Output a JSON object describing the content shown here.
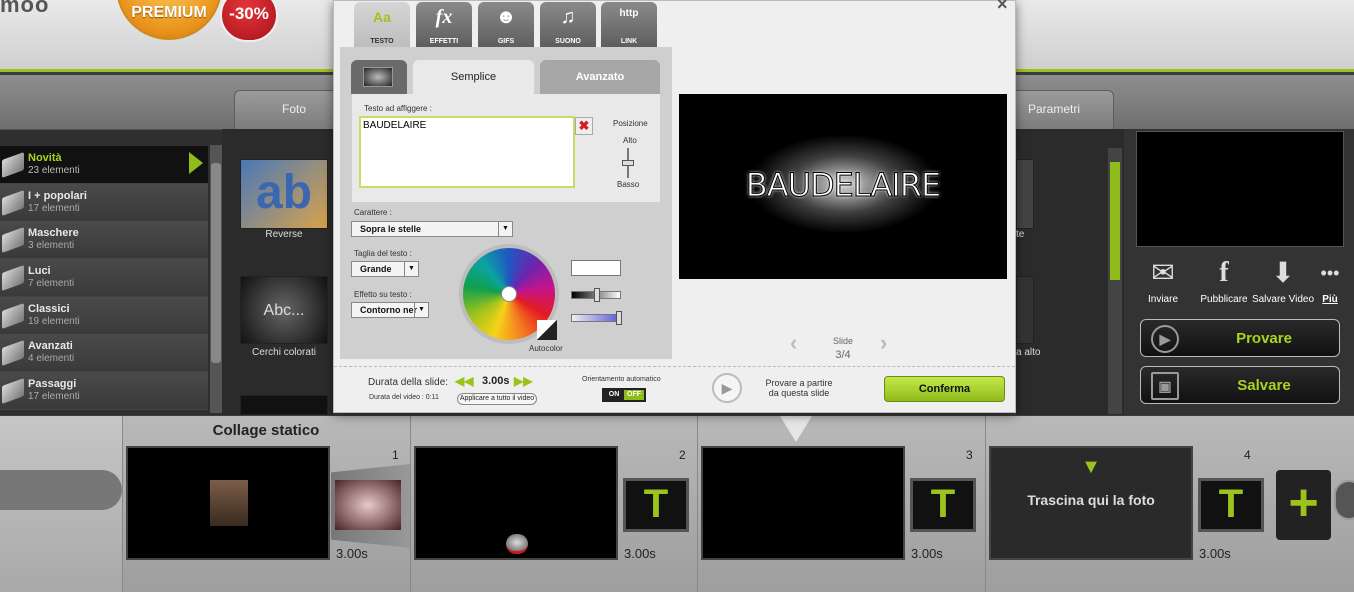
{
  "header": {
    "logo_fragment": "moo",
    "premium_label": "PREMIUM",
    "discount_label": "-30%"
  },
  "main_tabs": [
    "Foto",
    "Parametri"
  ],
  "categories": [
    {
      "name": "Novità",
      "count": "23 elementi",
      "active": true
    },
    {
      "name": "I + popolari",
      "count": "17 elementi"
    },
    {
      "name": "Maschere",
      "count": "3 elementi"
    },
    {
      "name": "Luci",
      "count": "7 elementi"
    },
    {
      "name": "Classici",
      "count": "19 elementi"
    },
    {
      "name": "Avanzati",
      "count": "4 elementi"
    },
    {
      "name": "Passaggi",
      "count": "17 elementi"
    }
  ],
  "thumbs": [
    {
      "label": "Reverse",
      "art": "ab"
    },
    {
      "label": "Cerchi colorati",
      "art": "Abc..."
    }
  ],
  "right_fragments": [
    "te",
    "a alto"
  ],
  "share": {
    "send": "Inviare",
    "publish": "Pubblicare",
    "save_video": "Salvare Video",
    "more": "Più"
  },
  "actions": {
    "try": "Provare",
    "save": "Salvare"
  },
  "modal": {
    "tool_tabs": [
      {
        "label": "TESTO",
        "icon": "Aa",
        "active": true
      },
      {
        "label": "EFFETTI",
        "icon": "fx"
      },
      {
        "label": "GIFS",
        "icon": "☻"
      },
      {
        "label": "SUONO",
        "icon": "♫"
      },
      {
        "label": "LINK",
        "icon": "http"
      }
    ],
    "sub_tabs": {
      "simple": "Semplice",
      "advanced": "Avanzato"
    },
    "text_label": "Testo ad affiggere :",
    "text_value": "BAUDELAIRE",
    "position_label": "Posizione",
    "position_high": "Alto",
    "position_low": "Basso",
    "font_label": "Carattere :",
    "font_value": "Sopra le stelle",
    "size_label": "Taglia del testo :",
    "size_value": "Grande",
    "effect_label": "Effetto su testo :",
    "effect_value": "Contorno ner",
    "autocolor_label": "Autocolor",
    "preview_text": "BAUDELAIRE",
    "slide_label": "Slide",
    "slide_counter": "3/4",
    "duration_label": "Durata della slide:",
    "duration_value": "3.00s",
    "video_duration": "Durata del video : 0:11",
    "apply_all": "Applicare a tutto il video",
    "auto_orient_label": "Orientamento automatico",
    "toggle_on": "ON",
    "toggle_off": "OFF",
    "play_from_line1": "Provare a partire",
    "play_from_line2": "da questa slide",
    "confirm": "Conferma",
    "close": "×"
  },
  "timeline": {
    "collage_title": "Collage statico",
    "slides": [
      {
        "num": "1",
        "duration": "3.00s"
      },
      {
        "num": "2",
        "duration": "3.00s"
      },
      {
        "num": "3",
        "duration": "3.00s"
      },
      {
        "num": "4",
        "duration": "3.00s",
        "drop_text": "Trascina qui la foto"
      }
    ],
    "text_marker": "T",
    "add": "+"
  },
  "colors": {
    "accent": "#9cc31c",
    "premium": "#e8911a",
    "discount": "#c4151c"
  }
}
